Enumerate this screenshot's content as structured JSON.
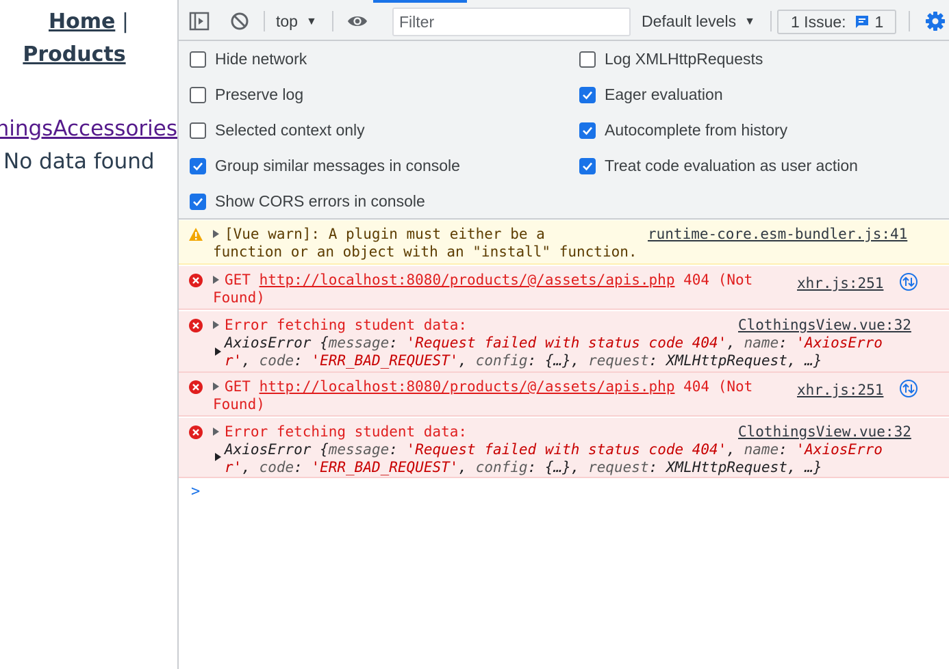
{
  "app": {
    "nav": {
      "home": "Home",
      "separator": "|",
      "products": "Products"
    },
    "category_link": "ClothingsAccessories",
    "empty_message": "No data found"
  },
  "devtools": {
    "toolbar": {
      "context": "top",
      "filter_placeholder": "Filter",
      "levels": "Default levels",
      "issues_label": "1 Issue:",
      "issues_count": "1"
    },
    "settings": {
      "left": [
        {
          "label": "Hide network",
          "checked": false
        },
        {
          "label": "Preserve log",
          "checked": false
        },
        {
          "label": "Selected context only",
          "checked": false
        },
        {
          "label": "Group similar messages in console",
          "checked": true
        },
        {
          "label": "Show CORS errors in console",
          "checked": true
        }
      ],
      "right": [
        {
          "label": "Log XMLHttpRequests",
          "checked": false
        },
        {
          "label": "Eager evaluation",
          "checked": true
        },
        {
          "label": "Autocomplete from history",
          "checked": true
        },
        {
          "label": "Treat code evaluation as user action",
          "checked": true
        }
      ]
    },
    "messages": [
      {
        "level": "warning",
        "line1": "[Vue warn]: A plugin must either be a",
        "line2": "function or an object with an \"install\" function.",
        "source": "runtime-core.esm-bundler.js:41"
      },
      {
        "level": "error",
        "method": "GET",
        "url": "http://localhost:8080/products/@/assets/apis.php",
        "status": "404 (Not",
        "status2": "Found)",
        "source": "xhr.js:251"
      },
      {
        "level": "error",
        "line1": "Error fetching student data:",
        "source": "ClothingsView.vue:32",
        "obj_name": "AxiosError",
        "k_message": "message",
        "v_message": "'Request failed with status code 404'",
        "k_name": "name",
        "v_name_a": "'AxiosErro",
        "v_name_b": "r'",
        "k_code": "code",
        "v_code": "'ERR_BAD_REQUEST'",
        "k_config": "config",
        "v_config": "{…}",
        "k_request": "request",
        "v_request": "XMLHttpRequest",
        "tail": "…}"
      },
      {
        "level": "error",
        "method": "GET",
        "url": "http://localhost:8080/products/@/assets/apis.php",
        "status": "404 (Not",
        "status2": "Found)",
        "source": "xhr.js:251"
      },
      {
        "level": "error",
        "line1": "Error fetching student data:",
        "source": "ClothingsView.vue:32",
        "obj_name": "AxiosError",
        "k_message": "message",
        "v_message": "'Request failed with status code 404'",
        "k_name": "name",
        "v_name_a": "'AxiosErro",
        "v_name_b": "r'",
        "k_code": "code",
        "v_code": "'ERR_BAD_REQUEST'",
        "k_config": "config",
        "v_config": "{…}",
        "k_request": "request",
        "v_request": "XMLHttpRequest",
        "tail": "…}"
      }
    ],
    "prompt": ">"
  },
  "colors": {
    "accent": "#1a73e8",
    "error": "#e01e1e",
    "warning_bg": "#fffbe5",
    "error_bg": "#fcebeb"
  }
}
